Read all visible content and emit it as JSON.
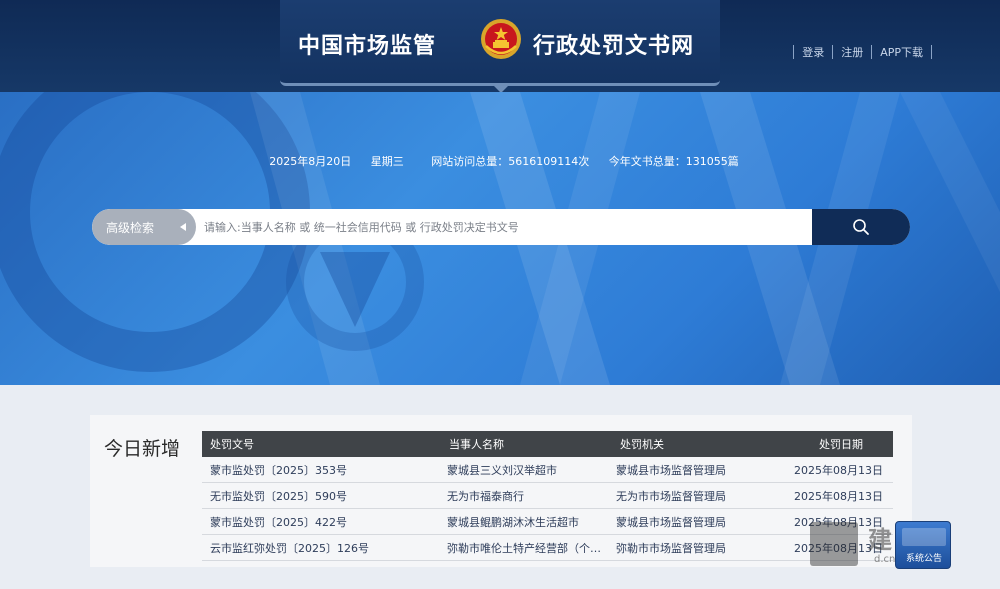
{
  "header": {
    "title_left": "中国市场监管",
    "title_right": "行政处罚文书网",
    "links": [
      "登录",
      "注册",
      "APP下载"
    ]
  },
  "stats": {
    "date": "2025年8月20日",
    "weekday": "星期三",
    "visits": "网站访问总量：5616109114次",
    "docs": "今年文书总量：131055篇"
  },
  "search": {
    "advanced_label": "高级检索",
    "placeholder": "请输入:当事人名称 或 统一社会信用代码 或 行政处罚决定书文号"
  },
  "today": {
    "label": "今日新增",
    "headers": [
      "处罚文号",
      "当事人名称",
      "处罚机关",
      "处罚日期"
    ],
    "rows": [
      [
        "蒙市监处罚〔2025〕353号",
        "蒙城县三义刘汉举超市",
        "蒙城县市场监督管理局",
        "2025年08月13日"
      ],
      [
        "无市监处罚〔2025〕590号",
        "无为市福泰商行",
        "无为市市场监督管理局",
        "2025年08月13日"
      ],
      [
        "蒙市监处罚〔2025〕422号",
        "蒙城县鲲鹏湖沐沐生活超市",
        "蒙城县市场监督管理局",
        "2025年08月13日"
      ],
      [
        "云市监红弥处罚〔2025〕126号",
        "弥勒市唯伦土特产经营部（个…",
        "弥勒市市场监督管理局",
        "2025年08月13日"
      ]
    ]
  },
  "watermark": {
    "text": "建教程",
    "site": "d.cn",
    "badge": "系统公告"
  },
  "colors": {
    "header": "#0f2a55",
    "hero": "#2e7cd6",
    "search_button": "#102c57",
    "table_header": "#404448"
  }
}
